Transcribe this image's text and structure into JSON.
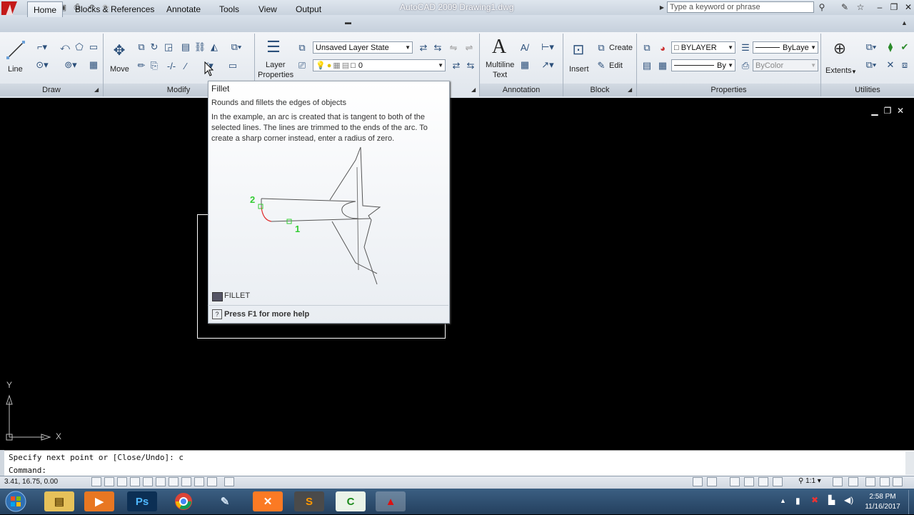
{
  "window": {
    "title_app": "AutoCAD 2009",
    "title_file": "Drawing1.dwg",
    "search_placeholder": "Type a keyword or phrase"
  },
  "tabs": [
    {
      "label": "Home",
      "active": true
    },
    {
      "label": "Blocks & References"
    },
    {
      "label": "Annotate"
    },
    {
      "label": "Tools"
    },
    {
      "label": "View"
    },
    {
      "label": "Output"
    }
  ],
  "ribbon": {
    "draw": {
      "title": "Draw",
      "line_label": "Line"
    },
    "modify": {
      "title": "Modify",
      "move_label": "Move"
    },
    "layers": {
      "layer_properties_label_1": "Layer",
      "layer_properties_label_2": "Properties",
      "layer_state_value": "Unsaved Layer State",
      "current_layer_value": "0"
    },
    "annotation": {
      "title": "Annotation",
      "mtext_label_1": "Multiline",
      "mtext_label_2": "Text"
    },
    "block": {
      "title": "Block",
      "insert_label": "Insert",
      "create_label": "Create",
      "edit_label": "Edit"
    },
    "properties": {
      "title": "Properties",
      "color_value": "BYLAYER",
      "linetype_value": "ByLaye",
      "lineweight_value": "By",
      "plotstyle_value": "ByColor"
    },
    "utilities": {
      "title": "Utilities",
      "extents_label": "Extents"
    }
  },
  "tooltip": {
    "title": "Fillet",
    "description": "Rounds and fillets the edges of objects",
    "body": "In the example, an arc is created that is tangent to both of the selected lines. The lines are trimmed to the ends of the arc. To create a sharp corner instead, enter a radius of zero.",
    "diagram_label_1": "1",
    "diagram_label_2": "2",
    "command": "FILLET",
    "help": "Press F1 for more help"
  },
  "ucs": {
    "x_label": "X",
    "y_label": "Y"
  },
  "command_line": {
    "history": "Specify next point or [Close/Undo]: c",
    "prompt": "Command:"
  },
  "status_bar": {
    "coordinates": "3.41, 16.75, 0.00",
    "annotation_scale": "1:1"
  },
  "taskbar": {
    "time": "2:58 PM",
    "date": "11/16/2017",
    "apps": [
      "start",
      "explorer",
      "media-player",
      "photoshop",
      "chrome",
      "paint-tool",
      "xampp",
      "sublime-text",
      "camtasia",
      "autocad"
    ]
  },
  "colors": {
    "diagram_green": "#33cc33",
    "diagram_red": "#e03030",
    "taskbar": "#2c4a6b"
  }
}
